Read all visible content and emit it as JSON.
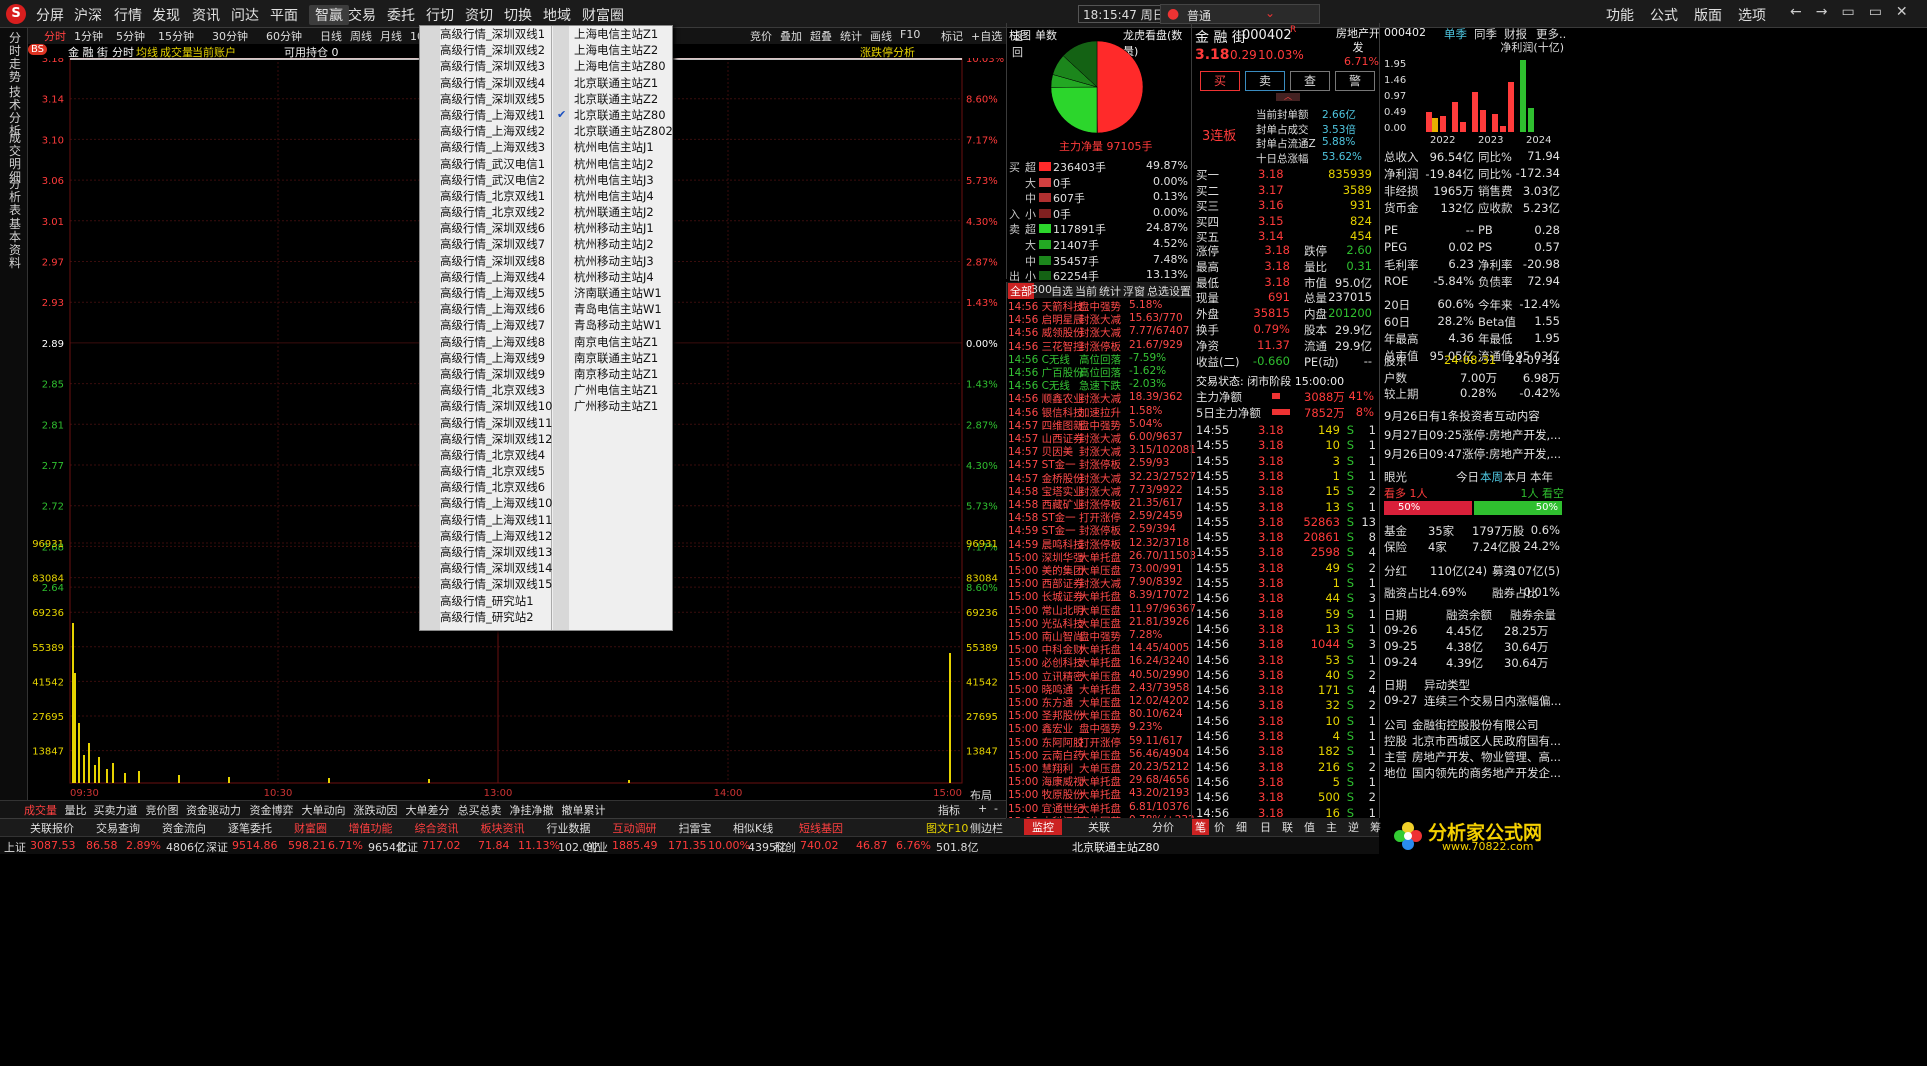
{
  "menu": {
    "items": [
      "分屏",
      "沪深",
      "行情",
      "发现",
      "资讯",
      "问达",
      "平面",
      "智赢",
      "交易",
      "委托",
      "行切",
      "资切",
      "切换",
      "地域",
      "财富圈"
    ],
    "active": "智赢",
    "clock": "18:15:47 周日",
    "account": "普通",
    "right": [
      "功能",
      "公式",
      "版面",
      "选项"
    ]
  },
  "chart_toolbar": {
    "periods": [
      "分时",
      "1分钟",
      "5分钟",
      "15分钟",
      "30分钟",
      "60分钟",
      "日线",
      "周线",
      "月线",
      "10分钟",
      "45日线",
      "季"
    ],
    "right_tools": [
      "竞价",
      "叠加",
      "超叠",
      "统计",
      "画线",
      "F10",
      "标记",
      "+自选",
      "返回"
    ]
  },
  "chart_header": {
    "bs": "BS",
    "name": "金 融 街",
    "type": "分时",
    "avg": "均线",
    "amt": "成交量",
    "account": "当前账户",
    "holding": "可用持仓 0",
    "right": "涨跌停分析"
  },
  "left_vtabs": [
    "分时走势",
    "技术分析",
    "成交明细",
    "分析表",
    "基本资料"
  ],
  "price_axis": {
    "left": [
      "3.18",
      "3.14",
      "3.10",
      "3.06",
      "3.01",
      "2.97",
      "2.93",
      "2.89",
      "2.85",
      "2.81",
      "2.77",
      "2.72",
      "2.68",
      "2.64"
    ],
    "right": [
      "10.03%",
      "8.60%",
      "7.17%",
      "5.73%",
      "4.30%",
      "2.87%",
      "1.43%",
      "0.00%",
      "1.43%",
      "2.87%",
      "4.30%",
      "5.73%",
      "7.17%",
      "8.60%"
    ]
  },
  "volume_axis": [
    "96931",
    "83084",
    "69236",
    "55389",
    "41542",
    "27695",
    "13847"
  ],
  "time_axis": [
    "09:30",
    "10:30",
    "13:00",
    "14:00",
    "15:00"
  ],
  "chart_data": {
    "type": "line",
    "price_range": [
      2.6,
      3.18
    ],
    "prev_close": 2.89,
    "last_price": 3.18,
    "volume_range": [
      0,
      96931
    ]
  },
  "watermark": "分析家公式网www.70822.com",
  "dropdown": {
    "col1": [
      "高级行情_深圳双线1",
      "高级行情_深圳双线2",
      "高级行情_深圳双线3",
      "高级行情_深圳双线4",
      "高级行情_深圳双线5",
      "高级行情_上海双线1",
      "高级行情_上海双线2",
      "高级行情_上海双线3",
      "高级行情_武汉电信1",
      "高级行情_武汉电信2",
      "高级行情_北京双线1",
      "高级行情_北京双线2",
      "高级行情_深圳双线6",
      "高级行情_深圳双线7",
      "高级行情_深圳双线8",
      "高级行情_上海双线4",
      "高级行情_上海双线5",
      "高级行情_上海双线6",
      "高级行情_上海双线7",
      "高级行情_上海双线8",
      "高级行情_上海双线9",
      "高级行情_深圳双线9",
      "高级行情_北京双线3",
      "高级行情_深圳双线10",
      "高级行情_深圳双线11",
      "高级行情_深圳双线12",
      "高级行情_北京双线4",
      "高级行情_北京双线5",
      "高级行情_北京双线6",
      "高级行情_上海双线10",
      "高级行情_上海双线11",
      "高级行情_上海双线12",
      "高级行情_深圳双线13",
      "高级行情_深圳双线14",
      "高级行情_深圳双线15",
      "高级行情_研究站1",
      "高级行情_研究站2"
    ],
    "col2": [
      "上海电信主站Z1",
      "上海电信主站Z2",
      "上海电信主站Z80",
      "北京联通主站Z1",
      "北京联通主站Z2",
      "北京联通主站Z80",
      "北京联通主站Z802",
      "杭州电信主站J1",
      "杭州电信主站J2",
      "杭州电信主站J3",
      "杭州电信主站J4",
      "杭州联通主站J2",
      "杭州移动主站J1",
      "杭州移动主站J2",
      "杭州移动主站J3",
      "杭州移动主站J4",
      "济南联通主站W1",
      "青岛电信主站W1",
      "青岛移动主站W1",
      "南京电信主站Z1",
      "南京联通主站Z1",
      "南京移动主站Z1",
      "广州电信主站Z1",
      "广州移动主站Z1"
    ],
    "checked": "北京联通主站Z80"
  },
  "pie": {
    "tabs": [
      "柱图",
      "单数"
    ],
    "title": "龙虎看盘(数量)",
    "net": "主力净量 97105手"
  },
  "flow": {
    "rows": [
      {
        "side": "买",
        "size": "超",
        "val": "236403手",
        "pct": "49.87%",
        "color": "#ff2a2a"
      },
      {
        "side": "",
        "size": "大",
        "val": "0手",
        "pct": "0.00%",
        "color": "#d24040"
      },
      {
        "side": "",
        "size": "中",
        "val": "607手",
        "pct": "0.13%",
        "color": "#b03030"
      },
      {
        "side": "入",
        "size": "小",
        "val": "0手",
        "pct": "0.00%",
        "color": "#802020"
      },
      {
        "side": "卖",
        "size": "超",
        "val": "117891手",
        "pct": "24.87%",
        "color": "#2cd62c"
      },
      {
        "side": "",
        "size": "大",
        "val": "21407手",
        "pct": "4.52%",
        "color": "#23a823"
      },
      {
        "side": "",
        "size": "中",
        "val": "35457手",
        "pct": "7.48%",
        "color": "#1c861c"
      },
      {
        "side": "出",
        "size": "小",
        "val": "62254手",
        "pct": "13.13%",
        "color": "#146214"
      }
    ]
  },
  "news_tabs": [
    "全部",
    "300",
    "自选",
    "当前",
    "统计",
    "浮窗",
    "总选",
    "设置"
  ],
  "news": [
    [
      "14:56 天箭科技",
      "盘中强势",
      "5.18%"
    ],
    [
      "14:56 启明星辰",
      "封涨大减",
      "15.63/770"
    ],
    [
      "14:56 威领股份",
      "封涨大减",
      "7.77/67407"
    ],
    [
      "14:56 三花智控",
      "封涨停板",
      "21.67/929"
    ],
    [
      "14:56 C无线",
      "高位回落",
      "-7.59%"
    ],
    [
      "14:56 广百股份",
      "高位回落",
      "-1.62%"
    ],
    [
      "14:56 C无线",
      "急速下跌",
      "-2.03%"
    ],
    [
      "14:56 顺鑫农业",
      "封涨大减",
      "18.39/362"
    ],
    [
      "14:56 银信科技",
      "加速拉升",
      "1.58%"
    ],
    [
      "14:57 四维图新",
      "盘中强势",
      "5.04%"
    ],
    [
      "14:57 山西证券",
      "封涨大减",
      "6.00/9637"
    ],
    [
      "14:57 贝因美",
      "封涨大减",
      "3.15/102081"
    ],
    [
      "14:57 ST金一",
      "封涨停板",
      "2.59/93"
    ],
    [
      "14:57 金桥股份",
      "封涨大减",
      "32.23/27527"
    ],
    [
      "14:58 宝塔实业",
      "封涨大减",
      "7.73/9922"
    ],
    [
      "14:58 西藏矿业",
      "封涨停板",
      "21.35/617"
    ],
    [
      "14:58 ST金一",
      "打开涨停",
      "2.59/2459"
    ],
    [
      "14:59 ST金一",
      "封涨停板",
      "2.59/394"
    ],
    [
      "14:59 晨鸣科技",
      "封涨停板",
      "12.32/3718"
    ],
    [
      "15:00 深圳华强",
      "大单托盘",
      "26.70/11503"
    ],
    [
      "15:00 美的集团",
      "大单压盘",
      "73.00/991"
    ],
    [
      "15:00 西部证券",
      "封涨大减",
      "7.90/8392"
    ],
    [
      "15:00 长城证券",
      "大单托盘",
      "8.39/17072"
    ],
    [
      "15:00 常山北明",
      "大单压盘",
      "11.97/96367"
    ],
    [
      "15:00 光弘科技",
      "大单压盘",
      "21.81/3926"
    ],
    [
      "15:00 南山智尚",
      "盘中强势",
      "7.28%"
    ],
    [
      "15:00 中科金财",
      "大单托盘",
      "14.45/4005"
    ],
    [
      "15:00 必创科技",
      "大单托盘",
      "16.24/3240"
    ],
    [
      "15:00 立讯精密",
      "大单压盘",
      "40.50/2990"
    ],
    [
      "15:00 晓鸣通",
      "大单托盘",
      "2.43/73958"
    ],
    [
      "15:00 东方通",
      "大单压盘",
      "12.02/4202"
    ],
    [
      "15:00 圣邦股份",
      "大单压盘",
      "80.10/624"
    ],
    [
      "15:00 鑫宏业",
      "盘中强势",
      "9.23%"
    ],
    [
      "15:00 东阿阿胶",
      "打开涨停",
      "59.11/617"
    ],
    [
      "15:00 云南白药",
      "大单压盘",
      "56.46/4904"
    ],
    [
      "15:00 慧翔利",
      "大单压盘",
      "20.23/5212"
    ],
    [
      "15:00 海康威视",
      "大单托盘",
      "29.68/4656"
    ],
    [
      "15:00 牧原股份",
      "大单托盘",
      "43.20/2193"
    ],
    [
      "15:00 宜通世纪",
      "大单托盘",
      "6.81/10376"
    ],
    [
      "15:00 中科江南",
      "高位回落",
      "0.78%/+232"
    ]
  ],
  "stock": {
    "name": "金 融 街",
    "code": "000402",
    "r": "R",
    "price": "3.18",
    "change": "0.29",
    "pct": "10.03%",
    "sector": "房地产开发",
    "sector_pct": "6.71%",
    "actions": [
      "买",
      "卖",
      "查",
      "警"
    ],
    "board": "3连板",
    "seal_rows": [
      [
        "当前封单额",
        "2.66亿"
      ],
      [
        "封单占成交",
        "3.53倍"
      ],
      [
        "封单占流通Z",
        "5.88%"
      ],
      [
        "十日总涨幅",
        "53.62%"
      ]
    ],
    "bids": [
      [
        "买一",
        "3.18",
        "835939"
      ],
      [
        "买二",
        "3.17",
        "3589"
      ],
      [
        "买三",
        "3.16",
        "931"
      ],
      [
        "买四",
        "3.15",
        "824"
      ],
      [
        "买五",
        "3.14",
        "454"
      ]
    ],
    "stats": [
      [
        "涨停",
        "3.18",
        "跌停",
        "2.60"
      ],
      [
        "最高",
        "3.18",
        "量比",
        "0.31"
      ],
      [
        "最低",
        "3.18",
        "市值",
        "95.0亿"
      ],
      [
        "现量",
        "691",
        "总量",
        "237015"
      ],
      [
        "外盘",
        "35815",
        "内盘",
        "201200"
      ],
      [
        "换手",
        "0.79%",
        "股本",
        "29.9亿"
      ],
      [
        "净资",
        "11.37",
        "流通",
        "29.9亿"
      ],
      [
        "收益(二)",
        "-0.660",
        "PE(动)",
        "--"
      ]
    ],
    "status": "交易状态: 闭市阶段 15:00:00",
    "main_net": [
      "主力净额",
      "3088万",
      "41%"
    ],
    "main_net5": [
      "5日主力净额",
      "7852万",
      "8%"
    ]
  },
  "ticks": [
    [
      "14:55",
      "3.18",
      "149",
      "S",
      "1"
    ],
    [
      "14:55",
      "3.18",
      "10",
      "S",
      "1"
    ],
    [
      "14:55",
      "3.18",
      "3",
      "S",
      "1"
    ],
    [
      "14:55",
      "3.18",
      "1",
      "S",
      "1"
    ],
    [
      "14:55",
      "3.18",
      "15",
      "S",
      "2"
    ],
    [
      "14:55",
      "3.18",
      "13",
      "S",
      "1"
    ],
    [
      "14:55",
      "3.18",
      "52863",
      "S",
      "13"
    ],
    [
      "14:55",
      "3.18",
      "20861",
      "S",
      "8"
    ],
    [
      "14:55",
      "3.18",
      "2598",
      "S",
      "4"
    ],
    [
      "14:55",
      "3.18",
      "49",
      "S",
      "2"
    ],
    [
      "14:55",
      "3.18",
      "1",
      "S",
      "1"
    ],
    [
      "14:56",
      "3.18",
      "44",
      "S",
      "3"
    ],
    [
      "14:56",
      "3.18",
      "59",
      "S",
      "1"
    ],
    [
      "14:56",
      "3.18",
      "13",
      "S",
      "1"
    ],
    [
      "14:56",
      "3.18",
      "1044",
      "S",
      "3"
    ],
    [
      "14:56",
      "3.18",
      "53",
      "S",
      "1"
    ],
    [
      "14:56",
      "3.18",
      "40",
      "S",
      "2"
    ],
    [
      "14:56",
      "3.18",
      "171",
      "S",
      "4"
    ],
    [
      "14:56",
      "3.18",
      "32",
      "S",
      "2"
    ],
    [
      "14:56",
      "3.18",
      "10",
      "S",
      "1"
    ],
    [
      "14:56",
      "3.18",
      "4",
      "S",
      "1"
    ],
    [
      "14:56",
      "3.18",
      "182",
      "S",
      "1"
    ],
    [
      "14:56",
      "3.18",
      "216",
      "S",
      "2"
    ],
    [
      "14:56",
      "3.18",
      "5",
      "S",
      "1"
    ],
    [
      "14:56",
      "3.18",
      "500",
      "S",
      "2"
    ],
    [
      "14:56",
      "3.18",
      "16",
      "S",
      "1"
    ],
    [
      "15:00",
      "3.18",
      "691",
      "S",
      "42"
    ]
  ],
  "fin": {
    "code": "000402",
    "tabs": [
      "单季",
      "同季",
      "财报",
      "更多.."
    ],
    "chart_title": "净利润(十亿)",
    "years": [
      "2022",
      "2023",
      "2024"
    ],
    "y_ticks": [
      "1.95",
      "1.46",
      "0.97",
      "0.49",
      "0.00"
    ],
    "rows": [
      [
        "总收入",
        "96.54亿",
        "同比%",
        "71.94"
      ],
      [
        "净利润",
        "-19.84亿",
        "同比%",
        "-172.34"
      ],
      [
        "非经损",
        "1965万",
        "销售费",
        "3.03亿"
      ],
      [
        "货币金",
        "132亿",
        "应收款",
        "5.23亿"
      ],
      [
        "PE",
        "--",
        "PB",
        "0.28"
      ],
      [
        "PEG",
        "0.02",
        "PS",
        "0.57"
      ],
      [
        "毛利率",
        "6.23",
        "净利率",
        "-20.98"
      ],
      [
        "ROE",
        "-5.84%",
        "负债率",
        "72.94"
      ],
      [
        "20日",
        "60.6%",
        "今年来",
        "-12.4%"
      ],
      [
        "60日",
        "28.2%",
        "Beta值",
        "1.55"
      ],
      [
        "年最高",
        "4.36",
        "年最低",
        "1.95"
      ],
      [
        "总市值",
        "95.05亿",
        "流通值",
        "95.03亿"
      ]
    ],
    "holders": [
      "股东",
      "24-08-31",
      "24-07-31"
    ],
    "holder_rows": [
      [
        "户数",
        "7.00万",
        "6.98万"
      ],
      [
        "较上期",
        "0.28%",
        "-0.42%"
      ]
    ],
    "news": [
      "9月26日有1条投资者互动内容",
      "9月27日09:25涨停:房地产开发,...",
      "9月26日09:47涨停:房地产开发,..."
    ],
    "vision_tabs": [
      "眼光",
      "今日",
      "本周",
      "本月",
      "本年"
    ],
    "bull": "看多 1人",
    "bear": "1人 看空",
    "bull_pct": "50%",
    "bear_pct": "50%",
    "inst": [
      [
        "基金",
        "35家",
        "1797万股",
        "0.6%"
      ],
      [
        "保险",
        "4家",
        "7.24亿股",
        "24.2%"
      ]
    ],
    "div": [
      "分红",
      "110亿(24)",
      "募资",
      "107亿(5)"
    ],
    "margin": [
      "融资占比",
      "4.69%",
      "融券占比",
      "0.01%"
    ],
    "margin_head": [
      "日期",
      "融资余额",
      "融券余量"
    ],
    "margin_rows": [
      [
        "09-26",
        "4.45亿",
        "28.25万"
      ],
      [
        "09-25",
        "4.38亿",
        "30.64万"
      ],
      [
        "09-24",
        "4.39亿",
        "30.64万"
      ]
    ],
    "abn_head": [
      "日期",
      "异动类型"
    ],
    "abn_row": [
      "09-27",
      "连续三个交易日内涨幅偏..."
    ],
    "company": [
      [
        "公司",
        "金融街控股股份有限公司"
      ],
      [
        "控股",
        "北京市西城区人民政府国有..."
      ],
      [
        "主营",
        "房地产开发、物业管理、高..."
      ],
      [
        "地位",
        "国内领先的商务地产开发企..."
      ]
    ],
    "bottom": "预测评级 板块族 主题库 选股策略"
  },
  "bottom_tabs": [
    "成交量",
    "量比",
    "买卖力道",
    "竞价图",
    "资金驱动力",
    "资金博弈",
    "大单动向",
    "涨跌动因",
    "大单差分",
    "总买总卖",
    "净挂净撤",
    "撤单累计"
  ],
  "bottom_right": [
    "指标",
    "布局",
    "+",
    "-"
  ],
  "func_bar": [
    "关联报价",
    "交易查询",
    "资金流向",
    "逐笔委托",
    "财富圈",
    "增值功能",
    "综合资讯",
    "板块资讯",
    "行业数据",
    "互动调研",
    "扫雷宝",
    "相似K线",
    "短线基因"
  ],
  "func_right": [
    "图文F10",
    "侧边栏"
  ],
  "panel_tabs": [
    "监控",
    "关联",
    "分价",
    "笔",
    "价",
    "细",
    "日",
    "联",
    "值",
    "主",
    "逆",
    "筹"
  ],
  "index_bar": [
    [
      "上证",
      "3087.53",
      "86.58",
      "2.89%",
      "4806亿"
    ],
    [
      "深证",
      "9514.86",
      "598.21",
      "6.71%",
      "9654亿"
    ],
    [
      "北证",
      "717.02",
      "71.84",
      "11.13%",
      "102.0亿"
    ],
    [
      "创业",
      "1885.49",
      "171.35",
      "10.00%",
      "4395亿"
    ],
    [
      "科创",
      "740.02",
      "46.87",
      "6.76%",
      "501.8亿"
    ]
  ],
  "status_right": "北京联通主站Z80",
  "brand": "分析家公式网",
  "brand_url": "www.70822.com"
}
